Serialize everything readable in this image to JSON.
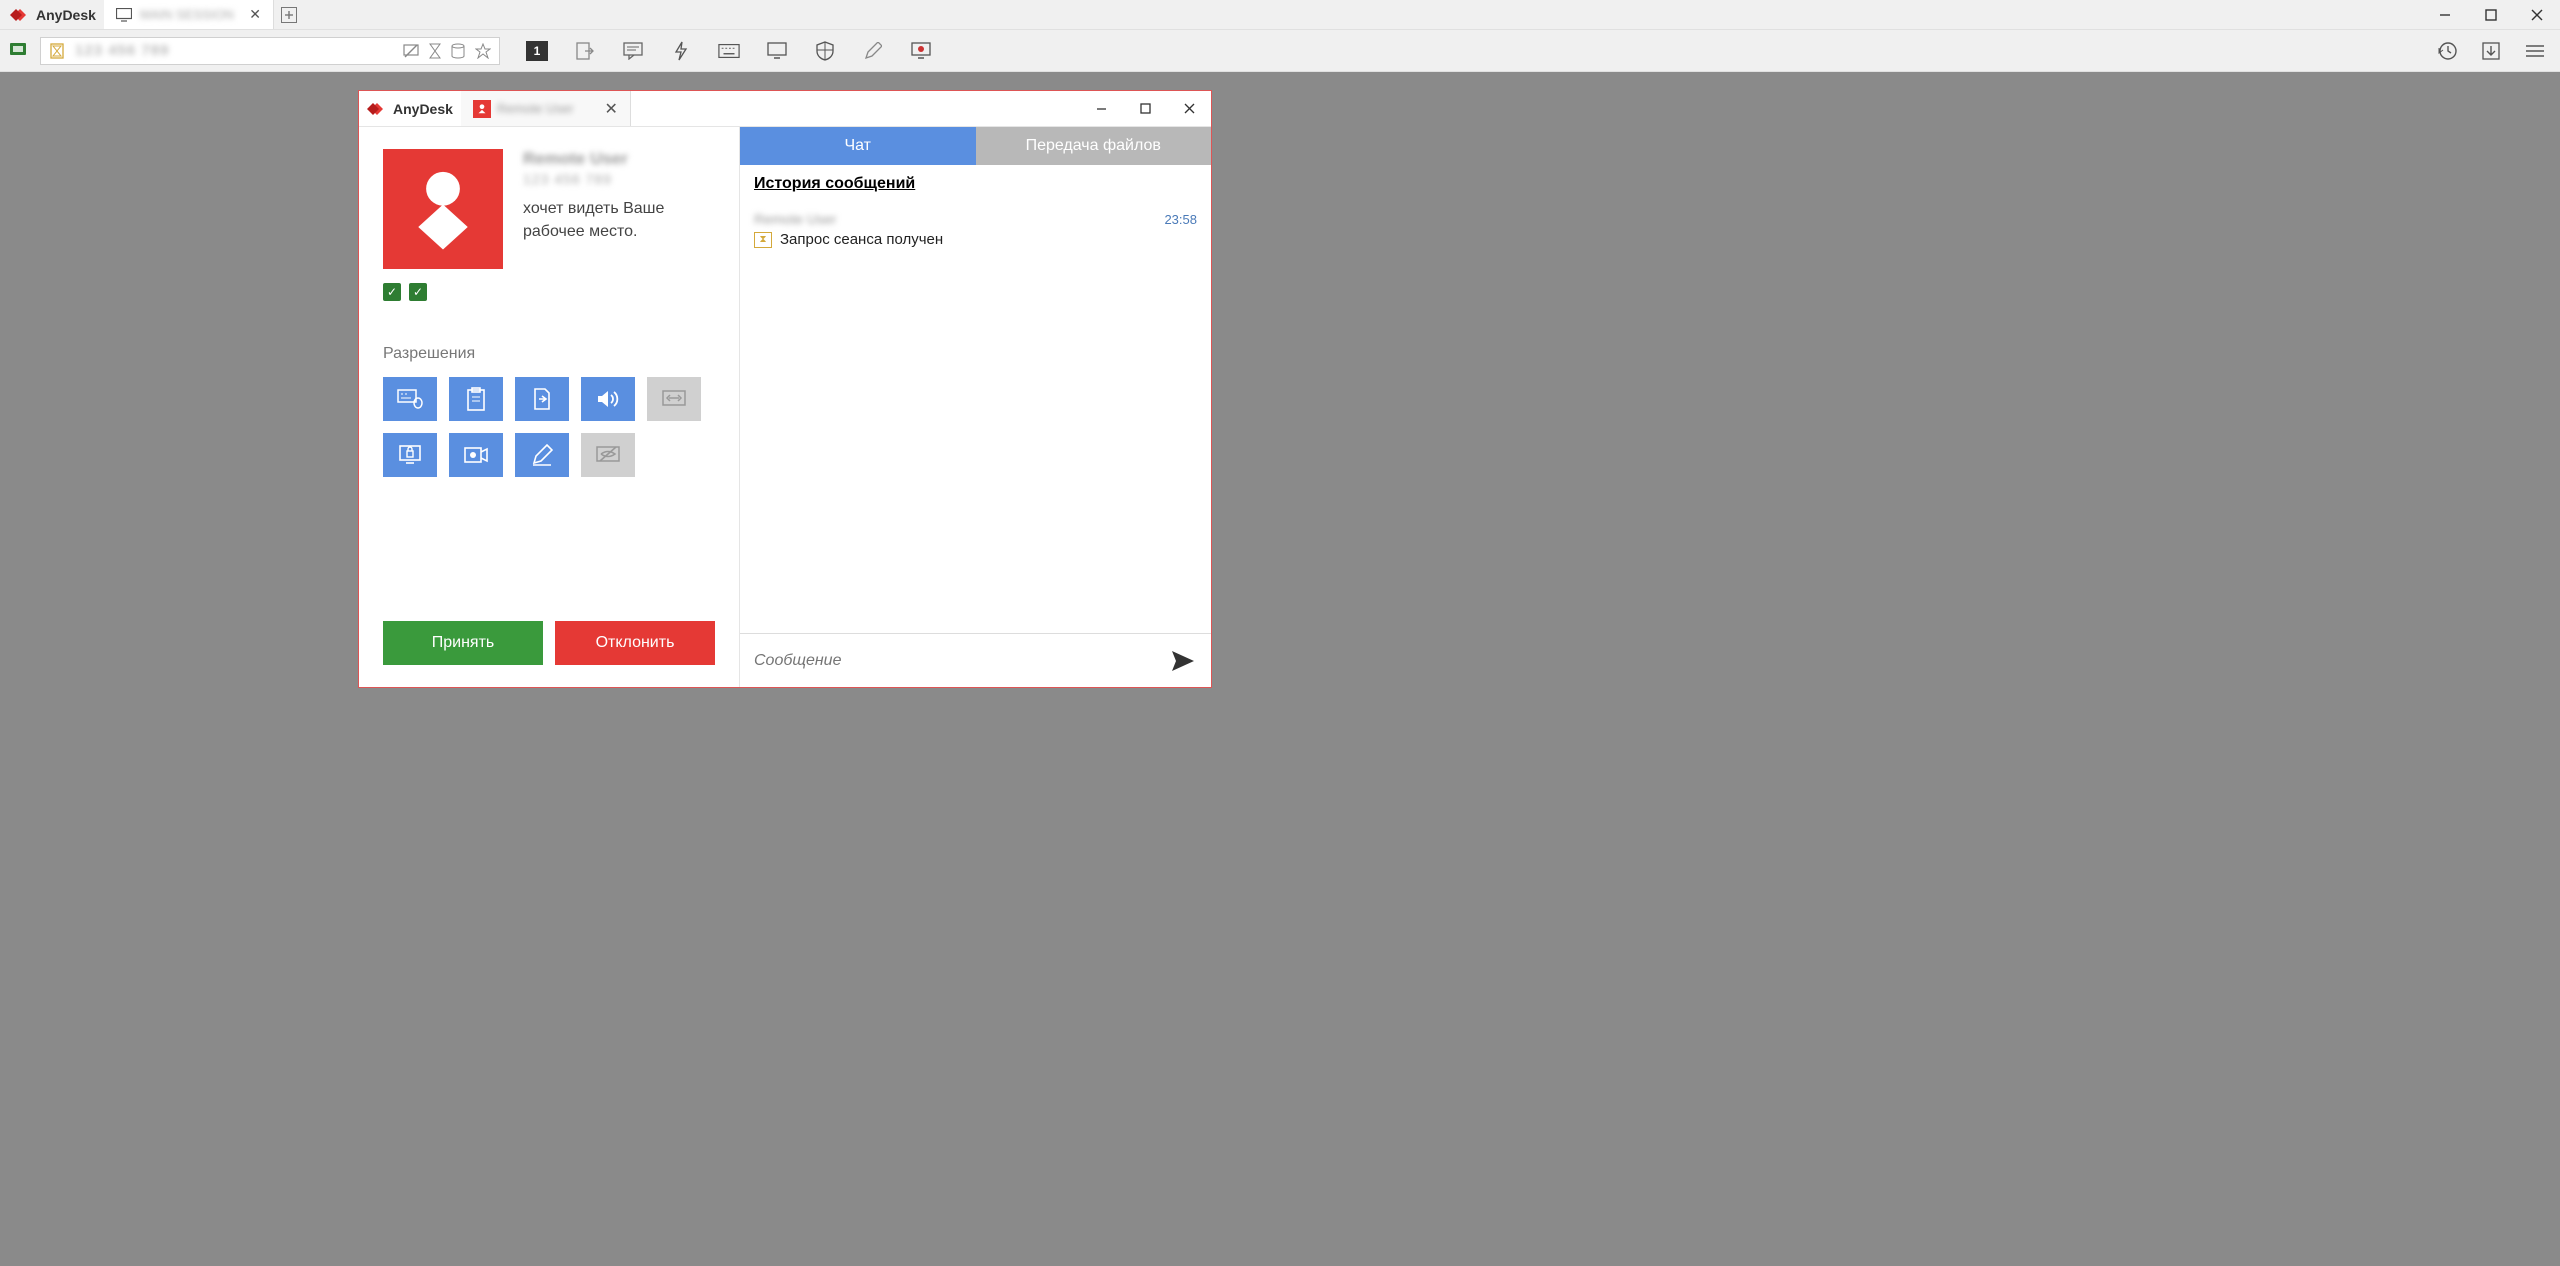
{
  "app": {
    "name": "AnyDesk",
    "main_tab_label": "MAIN SESSION",
    "session_badge": "1"
  },
  "address_bar": {
    "text": "123 456 789"
  },
  "dialog": {
    "app_name": "AnyDesk",
    "tab_label": "Remote User",
    "requester_name": "Remote User",
    "requester_id": "123 456 789",
    "request_text_line1": "хочет видеть Ваше",
    "request_text_line2": "рабочее место.",
    "permissions_title": "Разрешения",
    "accept_label": "Принять",
    "decline_label": "Отклонить",
    "tabs": {
      "chat": "Чат",
      "files": "Передача файлов"
    },
    "chat": {
      "history_header": "История сообщений",
      "sender": "Remote User",
      "time": "23:58",
      "message": "Запрос сеанса получен",
      "compose_placeholder": "Сообщение"
    }
  }
}
